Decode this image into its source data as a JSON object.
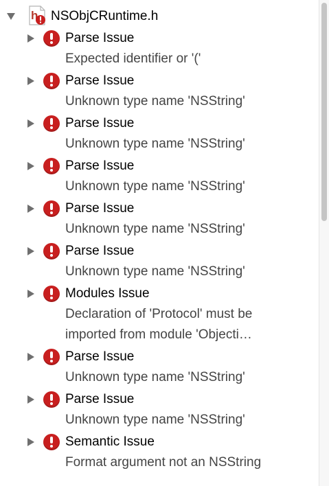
{
  "file": {
    "name": "NSObjCRuntime.h",
    "expanded": true,
    "icon": "header-file-error-icon"
  },
  "issues": [
    {
      "title": "Parse Issue",
      "message": [
        "Expected identifier or '('"
      ]
    },
    {
      "title": "Parse Issue",
      "message": [
        "Unknown type name 'NSString'"
      ]
    },
    {
      "title": "Parse Issue",
      "message": [
        "Unknown type name 'NSString'"
      ]
    },
    {
      "title": "Parse Issue",
      "message": [
        "Unknown type name 'NSString'"
      ]
    },
    {
      "title": "Parse Issue",
      "message": [
        "Unknown type name 'NSString'"
      ]
    },
    {
      "title": "Parse Issue",
      "message": [
        "Unknown type name 'NSString'"
      ]
    },
    {
      "title": "Modules Issue",
      "message": [
        "Declaration of 'Protocol' must be",
        "imported from module 'Objecti…"
      ]
    },
    {
      "title": "Parse Issue",
      "message": [
        "Unknown type name 'NSString'"
      ]
    },
    {
      "title": "Parse Issue",
      "message": [
        "Unknown type name 'NSString'"
      ]
    },
    {
      "title": "Semantic Issue",
      "message": [
        "Format argument not an NSString"
      ]
    }
  ],
  "colors": {
    "error_red": "#c81f1f",
    "title_text": "#000000",
    "message_text": "#444444",
    "disclosure_gray": "#6f6f6f"
  }
}
